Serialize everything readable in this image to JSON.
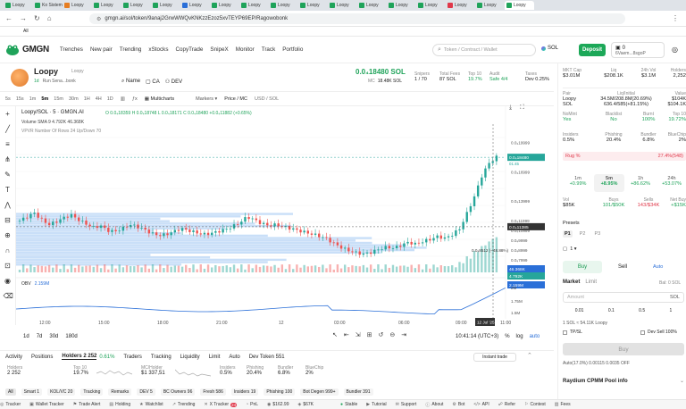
{
  "browser": {
    "tabs": [
      "Loopy",
      "Ko Sistema",
      "Loopy",
      "Loopy",
      "Loopy",
      "Loopy",
      "Loopy",
      "Loopy",
      "Loopy",
      "Loopy",
      "Loopy",
      "Loopy",
      "Loopy",
      "Loopy",
      "Loopy",
      "Loopy",
      "Loopy",
      "Loopy"
    ],
    "url": "gmgn.ai/sol/token/9anaj2GrwWWQvKNKzzEzoz5xvTEYP69EP/Ragowobonk",
    "bookmarks_label": "All"
  },
  "app": {
    "logo": "GMGN",
    "nav": [
      "Trenches",
      "New pair",
      "Trending",
      "xStocks",
      "CopyTrade",
      "SnipeX",
      "Monitor",
      "Track",
      "Portfolio"
    ],
    "search_placeholder": "Token / Contract / Wallet",
    "search_shortcut": "⌘K",
    "chain": "SOL",
    "deposit_label": "Deposit",
    "wallet_balance": "0",
    "wallet_address": "6Vaem...8sgoP"
  },
  "token": {
    "name": "Loopy",
    "subname": "Loopy",
    "age": "1d",
    "creator": "Run Sena...bonk",
    "links": [
      "Name",
      "CA",
      "DEV"
    ],
    "price": "0.0₄18480 SOL",
    "mc_label": "MC",
    "mc": "18.48K SOL",
    "stats": [
      {
        "label": "Snipers",
        "value": "1 / 70"
      },
      {
        "label": "Total Fees",
        "value": "87 SOL"
      },
      {
        "label": "Top 10",
        "value": "19.7%"
      },
      {
        "label": "Audit",
        "value": "Safe 4/4"
      },
      {
        "label": "Taxes",
        "value": "Dev 0.25%"
      }
    ]
  },
  "chart_toolbar": {
    "intervals": [
      "5s",
      "15s",
      "1m",
      "5m",
      "15m",
      "30m",
      "1H",
      "4H",
      "1D"
    ],
    "active_interval": "5m",
    "items": [
      "Multicharts",
      "Markers",
      "Price / MC",
      "USD / SOL"
    ]
  },
  "chart_legend": {
    "title": "Loopy/SOL · 5 · GMGN.AI",
    "ohlc": "O 0.0₄18359  H 0.0₄18748  L 0.0₄18171  C 0.0₄18480  +0.0₄11882 (+0.65%)",
    "volume": "Volume SMA 9  4.792K  46.368K",
    "vpvr": "VPVR Number Of Rows 24 Up/Down 70",
    "obv_label": "OBV",
    "obv_value": "2.159M"
  },
  "chart_data": {
    "type": "candlestick",
    "x_ticks": [
      "12:00",
      "15:00",
      "18:00",
      "21:00",
      "12",
      "03:00",
      "06:00",
      "09:00",
      "12 Jul '25",
      "11:00"
    ],
    "y_ticks": [
      "0.0₄19999",
      "0.0₄16999",
      "0.0₄13999",
      "0.0₄11999",
      "0.0₄10999",
      "0.0₄9999",
      "0.0₄8999",
      "0.0₄7999"
    ],
    "last_price_tag": "0.0₄18480",
    "last_price_time": "01:45",
    "crosshair_tag": "0.0₄11385",
    "low_annotation": "0.0₄8512 (−48.88%)",
    "volume_tags": [
      "46.368K",
      "4.792K"
    ],
    "obv_ticks": [
      "2M",
      "1.75M",
      "1.5M"
    ],
    "obv_tag": "2.159M",
    "close_series": [
      12.0,
      12.4,
      12.8,
      12.1,
      11.6,
      11.9,
      12.3,
      12.6,
      12.1,
      11.7,
      11.3,
      11.5,
      11.0,
      10.9,
      11.2,
      11.6,
      11.4,
      11.1,
      10.7,
      10.5,
      10.6,
      10.9,
      11.2,
      11.0,
      10.8,
      10.6,
      10.7,
      10.9,
      11.1,
      11.4,
      11.8,
      12.4,
      12.1,
      11.7,
      11.5,
      11.6,
      11.4,
      11.2,
      11.0,
      10.8,
      10.6,
      10.4,
      10.1,
      9.6,
      9.2,
      8.9,
      8.7,
      8.6,
      8.8,
      9.1,
      9.3,
      9.2,
      9.5,
      9.8,
      9.6,
      9.9,
      10.1,
      10.4,
      10.2,
      10.6,
      11.2,
      12.8,
      14.5,
      16.6,
      17.9,
      18.5
    ]
  },
  "bottom_toolbar": {
    "ranges": [
      "1d",
      "7d",
      "30d",
      "180d"
    ],
    "time": "10:41:14 (UTC+3)",
    "scale": [
      "%",
      "log",
      "auto"
    ]
  },
  "bottom_tabs": {
    "tabs": [
      "Activity",
      "Positions",
      "Holders 2 252",
      "Traders",
      "Tracking",
      "Liquidity",
      "Limit",
      "Auto",
      "Dev Token 551"
    ],
    "holders_delta": "0.61%",
    "instant_trade": "Instant trade",
    "metrics": [
      {
        "label": "Holders",
        "value": "2 252"
      },
      {
        "label": "Top 10",
        "value": "19.7%"
      },
      {
        "label": "MC/Holder",
        "value": "$1 337,51"
      },
      {
        "label": "Insiders",
        "value": "0.5%"
      },
      {
        "label": "Phishing",
        "value": "20.4%"
      },
      {
        "label": "Bundler",
        "value": "6.8%"
      },
      {
        "label": "BlueChip",
        "value": "2%"
      }
    ],
    "filters": [
      "All",
      "Smart 1",
      "KOL/VC 20",
      "Tracking",
      "Remarks",
      "DEV 5",
      "BC Owners 96",
      "Fresh 586",
      "Insiders 19",
      "Phishing 100",
      "Bot Degen 999+",
      "Bundler 391"
    ]
  },
  "right_panel": {
    "top_stats": [
      {
        "label": "MKT Cap",
        "value": "$3.01M"
      },
      {
        "label": "Liq",
        "value": "$208.1K"
      },
      {
        "label": "24h Vol",
        "value": "$3.1M"
      },
      {
        "label": "Holders",
        "value": "2,252"
      }
    ],
    "pair": {
      "label": "Pair",
      "token": "Loopy",
      "quote": "SOL"
    },
    "liq_initial": {
      "label": "Liq/Initial",
      "line1": "34.5M/208.8M(20.69%)",
      "line2": "636.4/585(+81.15%)"
    },
    "value": {
      "label": "Value",
      "line1": "$104K",
      "line2": "$104.1K"
    },
    "security": [
      {
        "label": "NoMint",
        "value": "Yes"
      },
      {
        "label": "Blacklist",
        "value": "No"
      },
      {
        "label": "Burnt",
        "value": "100%"
      },
      {
        "label": "Top 10",
        "value": "19.72%"
      }
    ],
    "holders_breakdown": [
      {
        "label": "Insiders",
        "value": "0.5%"
      },
      {
        "label": "Phishing",
        "value": "20.4%"
      },
      {
        "label": "Bundler",
        "value": "6.8%"
      },
      {
        "label": "BlueChip",
        "value": "2%"
      }
    ],
    "rug_label": "Rug %",
    "rug_value": "27.4%(548)",
    "periods": [
      {
        "label": "1m",
        "value": "+0.99%"
      },
      {
        "label": "5m",
        "value": "+8.95%"
      },
      {
        "label": "1h",
        "value": "+86.62%"
      },
      {
        "label": "24h",
        "value": "+53.07%"
      }
    ],
    "vol_row": [
      {
        "label": "Vol",
        "value": "$85K"
      },
      {
        "label": "Buys",
        "value": "101/$50K"
      },
      {
        "label": "Sells",
        "value": "143/$34K"
      },
      {
        "label": "Net Buy",
        "value": "+$15K"
      }
    ],
    "presets_label": "Presets",
    "presets": [
      "P1",
      "P2",
      "P3"
    ],
    "buy_label": "Buy",
    "sell_label": "Sell",
    "auto_label": "Auto",
    "market_label": "Market",
    "limit_label": "Limit",
    "bal_label": "Bal: 0 SOL",
    "amount_placeholder": "Amount",
    "amounts": [
      "0.01",
      "0.1",
      "0.5",
      "1"
    ],
    "quote_line": "1 SOL ≈ 54.11K Loopy",
    "tpsl_label": "TP/SL",
    "devsell_label": "Dev Sell 100%",
    "buy_button": "Buy",
    "fees_line": "Auto(17.0%)   0.00115   0.0035   OFF",
    "pool_label": "Raydium CPMM Pool info"
  },
  "taskbar": {
    "items": [
      "Tracker",
      "Wallet Tracker",
      "Trade Alert",
      "Holding",
      "Watchlist",
      "Trending",
      "X Tracker",
      "PnL",
      "$162.99",
      "$67K",
      "Stable",
      "Tutorial",
      "Support",
      "About",
      "Bot",
      "API",
      "Refer",
      "Contest",
      "Fees"
    ],
    "x_tracker_badge": "24"
  },
  "colors": {
    "brand_green": "#1fa35a",
    "deposit_green": "#1ca858",
    "red": "#e0384a",
    "up_candle": "#26a69a",
    "down_candle": "#ef5350",
    "vpvr_blue": "#9cc4f2",
    "obv_blue": "#2a6fd8"
  }
}
